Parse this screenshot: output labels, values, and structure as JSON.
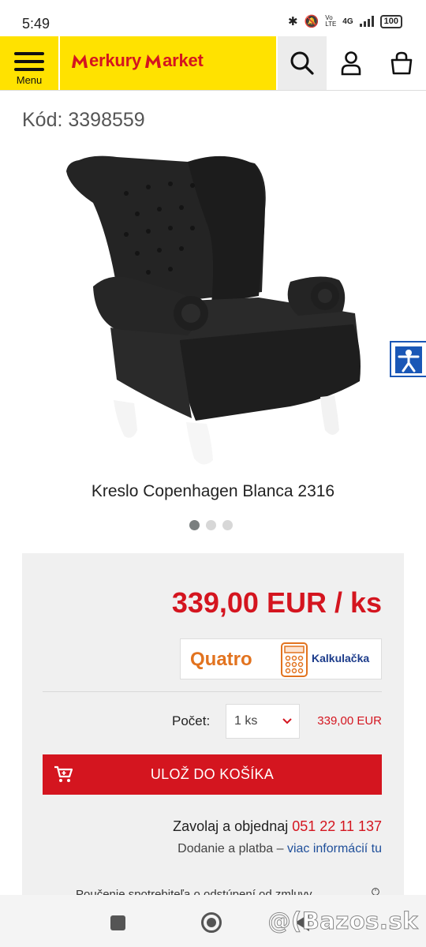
{
  "status": {
    "time": "5:49",
    "network": "4G",
    "volte": "Vo LTE",
    "battery": "100"
  },
  "header": {
    "menu_label": "Menu",
    "logo_text_1": "erkury",
    "logo_text_2": "arket"
  },
  "product": {
    "code": "Kód: 3398559",
    "title": "Kreslo Copenhagen Blanca 2316",
    "image_count": 3,
    "active_image": 1
  },
  "purchase": {
    "price": "339,00 EUR / ks",
    "quatro_brand": "Quatro",
    "quatro_calculator": "Kalkulačka",
    "qty_label": "Počet:",
    "qty_value": "1 ks",
    "qty_total": "339,00 EUR",
    "add_to_cart": "ULOŽ DO KOŠÍKA",
    "call_text": "Zavolaj a objednaj ",
    "phone": "051 22 11 137",
    "delivery_text": "Dodanie a platba – ",
    "delivery_link": "viac informácií tu",
    "cutoff_text": "Poučenie spotrebiteľa o odstúpení od zmluvy"
  },
  "watermark": "@(Bazos.sk",
  "colors": {
    "brand_yellow": "#ffe200",
    "brand_red": "#d4151f",
    "accessibility_blue": "#1a57b6"
  }
}
